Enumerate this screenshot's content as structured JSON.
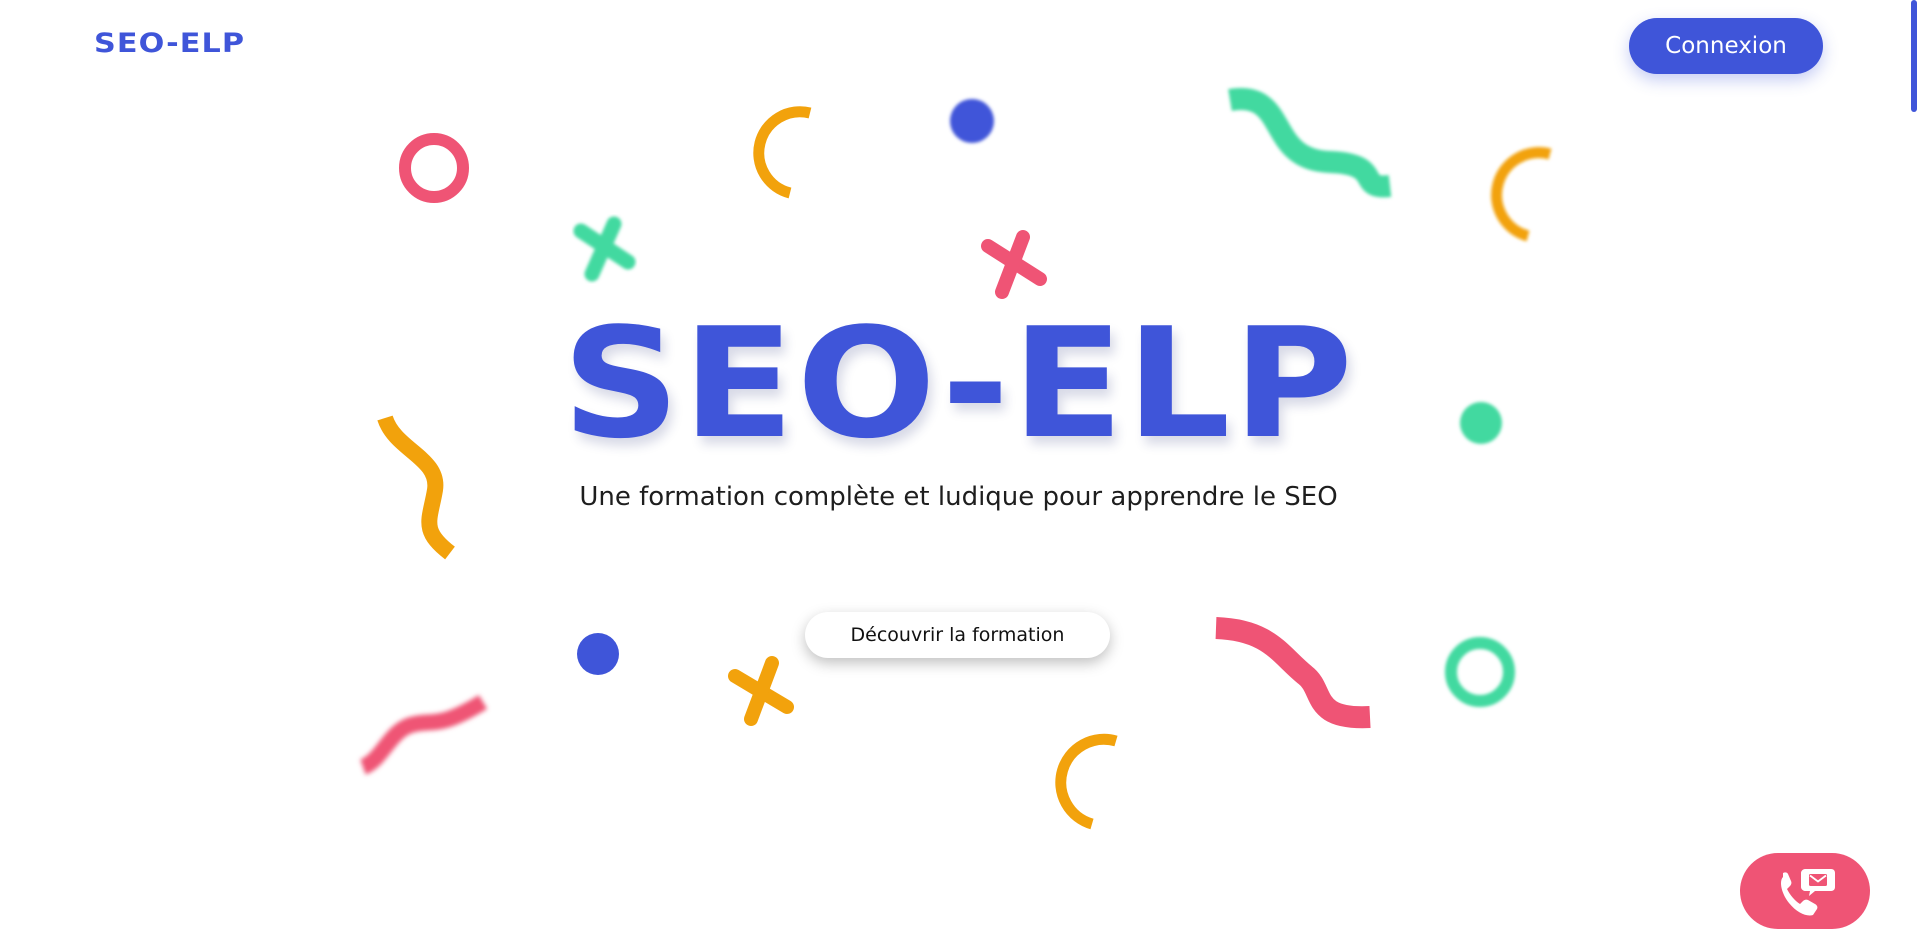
{
  "header": {
    "logo_text": "SEO-ELP",
    "login_label": "Connexion"
  },
  "hero": {
    "title": "SEO-ELP",
    "subtitle": "Une formation complète et ludique pour apprendre le SEO",
    "cta_label": "Découvrir la formation"
  },
  "contact_widget": {
    "icon": "phone-mail-icon"
  },
  "colors": {
    "brand_blue": "#3f55d9",
    "pink": "#ef5475",
    "orange": "#f2a20c",
    "green": "#43d9a0",
    "text_dark": "#1e1e1e"
  },
  "decorations": {
    "shape_types": [
      "ring",
      "arc",
      "dot",
      "squiggle",
      "cross"
    ]
  }
}
